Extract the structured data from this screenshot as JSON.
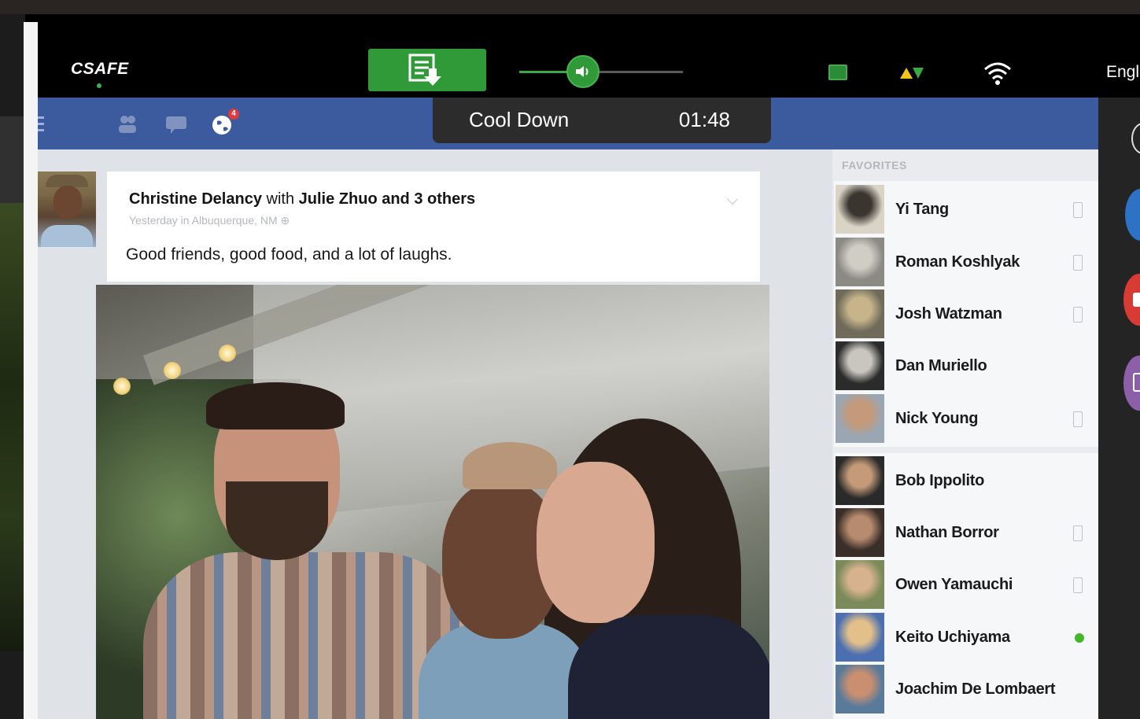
{
  "console": {
    "brand": "CSAFE",
    "language": "Engl",
    "icons": [
      "sync-download-icon",
      "volume-icon",
      "screen-icon",
      "signal-arrows-icon",
      "wifi-icon"
    ],
    "accent_color": "#2f9a37"
  },
  "workout": {
    "phase": "Cool Down",
    "time": "01:48"
  },
  "facebook": {
    "nav_color": "#3b5b9e",
    "notification_count": "4",
    "post": {
      "author": "Christine Delancy",
      "with_text": "with",
      "tagged": "Julie Zhuo and 3 others",
      "meta": "Yesterday in Albuquerque, NM",
      "body": "Good friends, good food, and a lot of laughs."
    },
    "sidebar": {
      "favorites_header": "FAVORITES",
      "favorites": [
        {
          "name": "Yi Tang",
          "status": "mobile"
        },
        {
          "name": "Roman Koshlyak",
          "status": "mobile"
        },
        {
          "name": "Josh Watzman",
          "status": "mobile"
        },
        {
          "name": "Dan Muriello",
          "status": "none"
        },
        {
          "name": "Nick Young",
          "status": "mobile"
        }
      ],
      "others": [
        {
          "name": "Bob Ippolito",
          "status": "none"
        },
        {
          "name": "Nathan Borror",
          "status": "mobile"
        },
        {
          "name": "Owen Yamauchi",
          "status": "mobile"
        },
        {
          "name": "Keito Uchiyama",
          "status": "online"
        },
        {
          "name": "Joachim De Lombaert",
          "status": "none"
        }
      ]
    }
  }
}
